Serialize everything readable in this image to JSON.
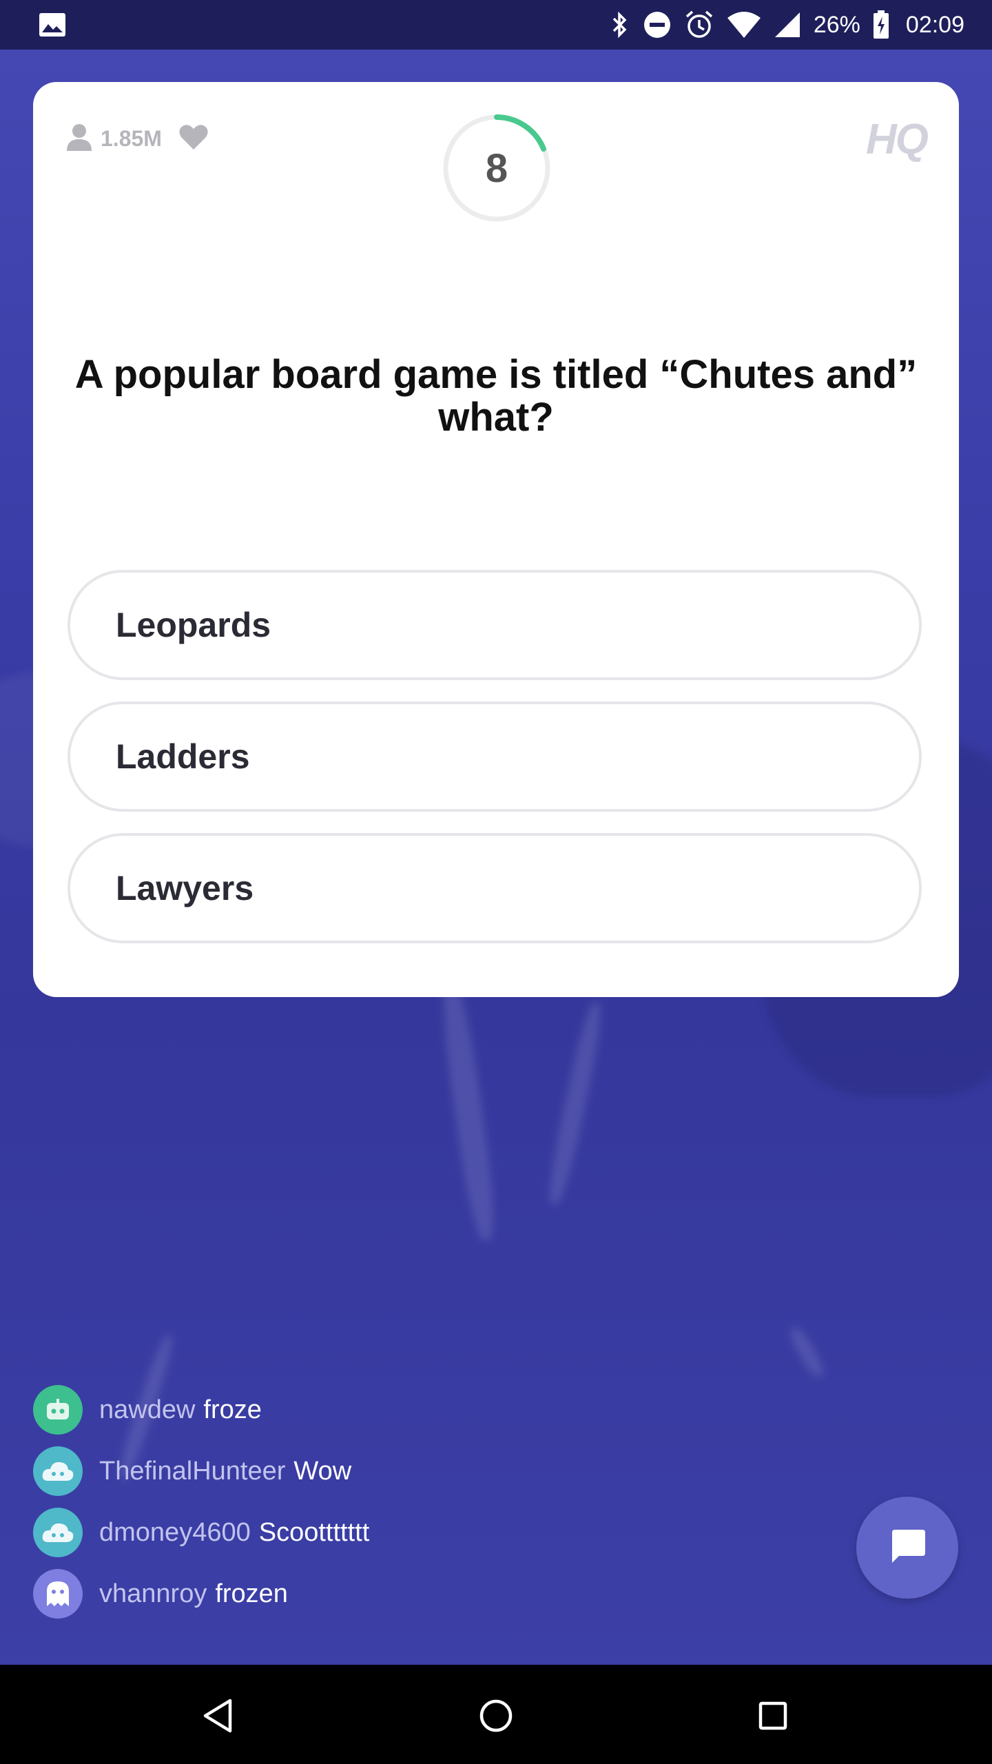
{
  "status_bar": {
    "battery_percent": "26%",
    "time": "02:09",
    "icons": [
      "gallery-icon",
      "bluetooth-icon",
      "do-not-disturb-icon",
      "alarm-icon",
      "wifi-icon",
      "signal-icon",
      "battery-charging-icon"
    ]
  },
  "header": {
    "viewer_count": "1.85M",
    "timer": "8",
    "logo": "HQ"
  },
  "question": {
    "text": "A popular board game is titled “Chutes and” what?"
  },
  "answers": [
    {
      "label": "Leopards"
    },
    {
      "label": "Ladders"
    },
    {
      "label": "Lawyers"
    }
  ],
  "chat": [
    {
      "user": "nawdew",
      "message": "froze",
      "avatar": "robot-avatar-icon",
      "avatar_color": "#3dbf8f"
    },
    {
      "user": "ThefinalHunteer",
      "message": "Wow",
      "avatar": "cloud-avatar-icon",
      "avatar_color": "#4fb8c9"
    },
    {
      "user": "dmoney4600",
      "message": "Scoottttttt",
      "avatar": "cloud-avatar-icon",
      "avatar_color": "#4fb8c9"
    },
    {
      "user": "vhannroy",
      "message": "frozen",
      "avatar": "ghost-avatar-icon",
      "avatar_color": "#7e7fe0"
    }
  ],
  "colors": {
    "background": "#3a3c9e",
    "timer_progress": "#49c98e",
    "chat_button": "#6063c8"
  }
}
